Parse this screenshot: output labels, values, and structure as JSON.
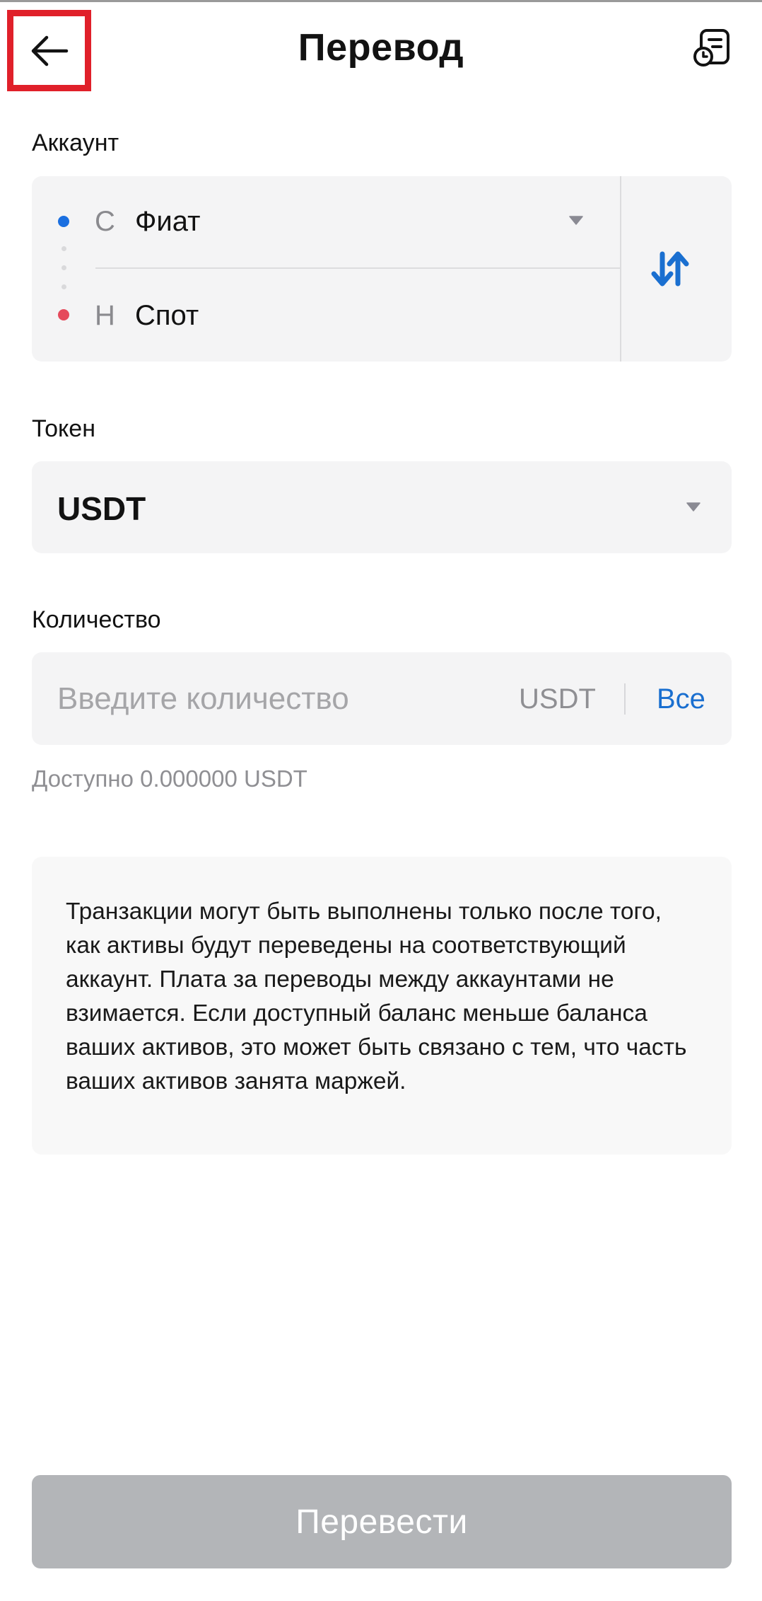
{
  "header": {
    "title": "Перевод",
    "back_icon": "arrow-left-icon",
    "history_icon": "history-document-icon"
  },
  "account": {
    "label": "Аккаунт",
    "from": {
      "prefix": "С",
      "name": "Фиат",
      "dot_color": "#1a6fe0"
    },
    "to": {
      "prefix": "Н",
      "name": "Спот",
      "dot_color": "#e54a5c"
    },
    "swap_icon": "swap-arrows-icon"
  },
  "token": {
    "label": "Токен",
    "value": "USDT"
  },
  "amount": {
    "label": "Количество",
    "placeholder": "Введите количество",
    "value": "",
    "unit": "USDT",
    "all_label": "Все",
    "available": "Доступно 0.000000 USDT"
  },
  "info": {
    "text": "Транзакции могут быть выполнены только после того, как активы будут переведены на соответствующий аккаунт. Плата за переводы между аккаунтами не взимается. Если доступный баланс меньше баланса ваших активов, это может быть связано с тем, что часть ваших активов занята маржей."
  },
  "submit": {
    "label": "Перевести",
    "disabled": true
  },
  "colors": {
    "accent": "#1a6fd0",
    "button_disabled": "#b3b5b8",
    "highlight": "#e0202a"
  }
}
